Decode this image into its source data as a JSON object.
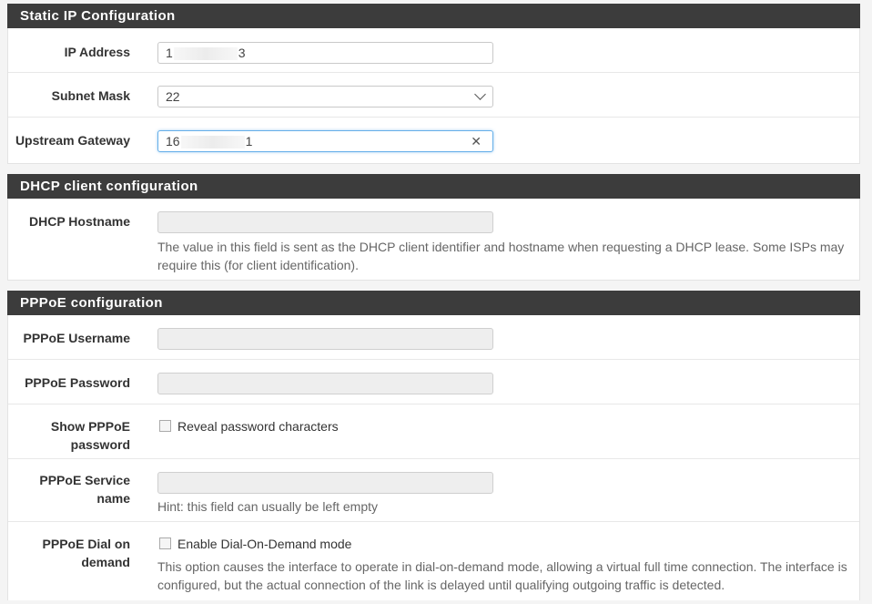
{
  "static_ip": {
    "heading": "Static IP Configuration",
    "ip_label": "IP Address",
    "ip_prefix": "1",
    "ip_suffix": "3",
    "subnet_label": "Subnet Mask",
    "subnet_value": "22",
    "gateway_label": "Upstream Gateway",
    "gateway_prefix": "16",
    "gateway_suffix": "1"
  },
  "dhcp": {
    "heading": "DHCP client configuration",
    "hostname_label": "DHCP Hostname",
    "hostname_help": "The value in this field is sent as the DHCP client identifier and hostname when requesting a DHCP lease. Some ISPs may require this (for client identification)."
  },
  "pppoe": {
    "heading": "PPPoE configuration",
    "username_label": "PPPoE Username",
    "password_label": "PPPoE Password",
    "show_password_label_1": "Show PPPoE",
    "show_password_label_2": "password",
    "reveal_text": "Reveal password characters",
    "service_label_1": "PPPoE Service",
    "service_label_2": "name",
    "service_hint": "Hint: this field can usually be left empty",
    "dial_label_1": "PPPoE Dial on",
    "dial_label_2": "demand",
    "dial_text": "Enable Dial-On-Demand mode",
    "dial_help": "This option causes the interface to operate in dial-on-demand mode, allowing a virtual full time connection. The interface is configured, but the actual connection of the link is delayed until qualifying outgoing traffic is detected."
  }
}
